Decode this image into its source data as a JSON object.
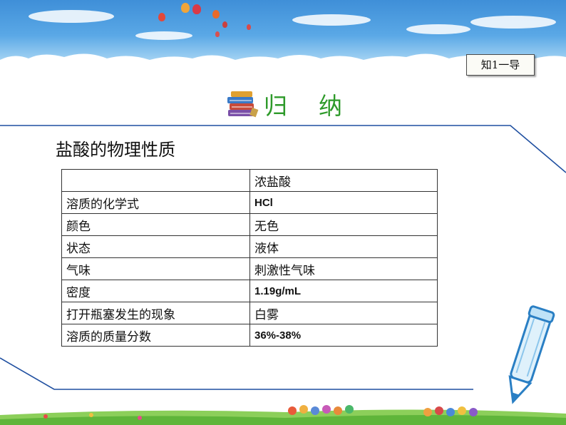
{
  "badge": {
    "label": "知1一导"
  },
  "heading": {
    "title": "归纳",
    "icon": "books-icon"
  },
  "subtitle": "盐酸的物理性质",
  "table": {
    "header": [
      "",
      "浓盐酸"
    ],
    "rows": [
      [
        "溶质的化学式",
        "HCl"
      ],
      [
        "颜色",
        "无色"
      ],
      [
        "状态",
        "液体"
      ],
      [
        "气味",
        "刺激性气味"
      ],
      [
        "密度",
        "1.19g/mL"
      ],
      [
        "打开瓶塞发生的现象",
        "白雾"
      ],
      [
        "溶质的质量分数",
        "36%-38%"
      ]
    ]
  },
  "colors": {
    "accent_green": "#2e9a2a",
    "line_blue": "#1f4fa0",
    "sky_blue": "#3f8fd8"
  }
}
